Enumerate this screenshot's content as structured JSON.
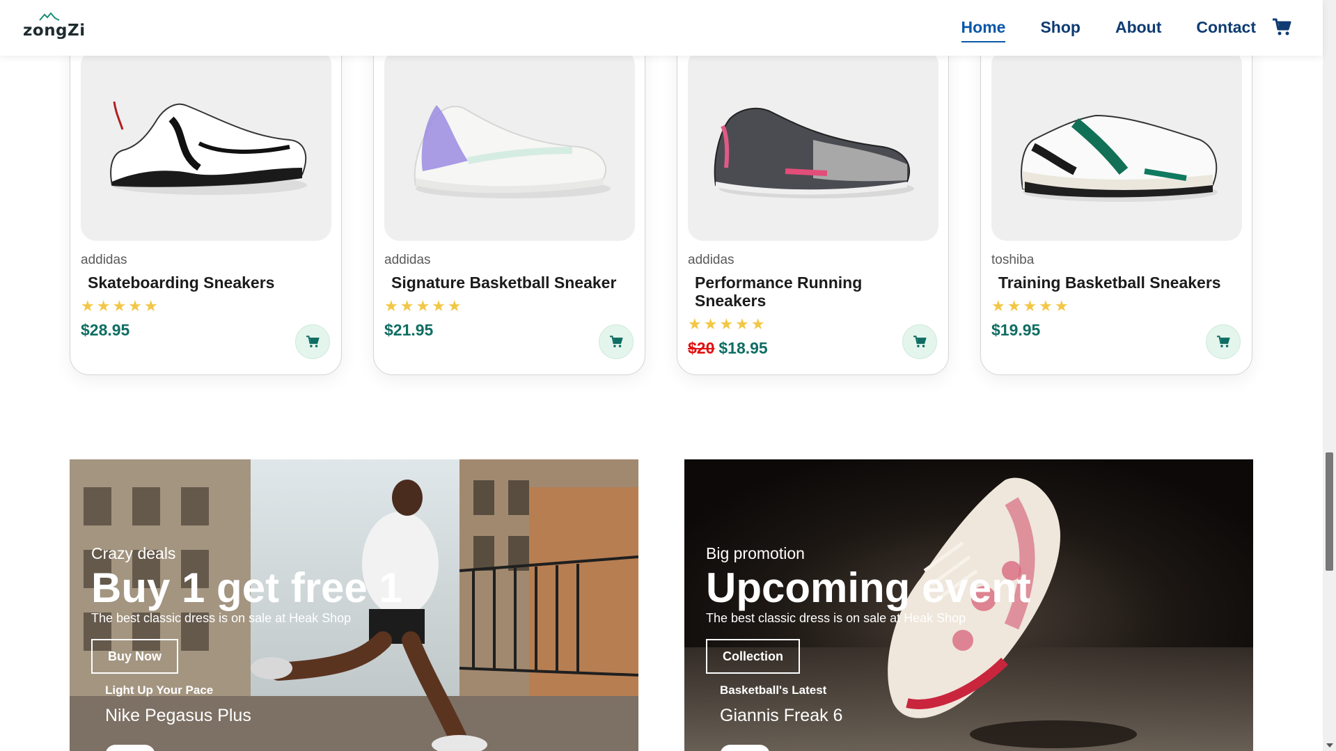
{
  "brand": {
    "logo_text": "zongZi"
  },
  "nav": {
    "items": [
      {
        "label": "Home",
        "active": true
      },
      {
        "label": "Shop",
        "active": false
      },
      {
        "label": "About",
        "active": false
      },
      {
        "label": "Contact",
        "active": false
      }
    ],
    "cart_icon": "cart-icon"
  },
  "products": [
    {
      "brand": "addidas",
      "title": "Skateboarding Sneakers",
      "rating": 5,
      "price": "$28.95",
      "old_price": ""
    },
    {
      "brand": "addidas",
      "title": "Signature Basketball Sneaker",
      "rating": 5,
      "price": "$21.95",
      "old_price": ""
    },
    {
      "brand": "addidas",
      "title": "Performance Running Sneakers",
      "rating": 5,
      "price": "$18.95",
      "old_price": "$20"
    },
    {
      "brand": "toshiba",
      "title": "Training Basketball Sneakers",
      "rating": 5,
      "price": "$19.95",
      "old_price": ""
    }
  ],
  "banners": [
    {
      "kicker": "Crazy deals",
      "headline": "Buy 1 get free 1",
      "subtitle": "The best classic dress is on sale at Heak Shop",
      "button": "Buy Now",
      "feature_kicker": "Light Up Your Pace",
      "feature_title": "Nike Pegasus Plus"
    },
    {
      "kicker": "Big promotion",
      "headline": "Upcoming event",
      "subtitle": "The best classic dress is on sale at Heak Shop",
      "button": "Collection",
      "feature_kicker": "Basketball's Latest",
      "feature_title": "Giannis Freak 6"
    }
  ],
  "colors": {
    "nav_text": "#0e3b72",
    "nav_active": "#0a57a8",
    "price": "#0f6d63",
    "old_price": "#e01010",
    "star": "#f2c744",
    "cart_button_bg": "#e3f5ec"
  }
}
